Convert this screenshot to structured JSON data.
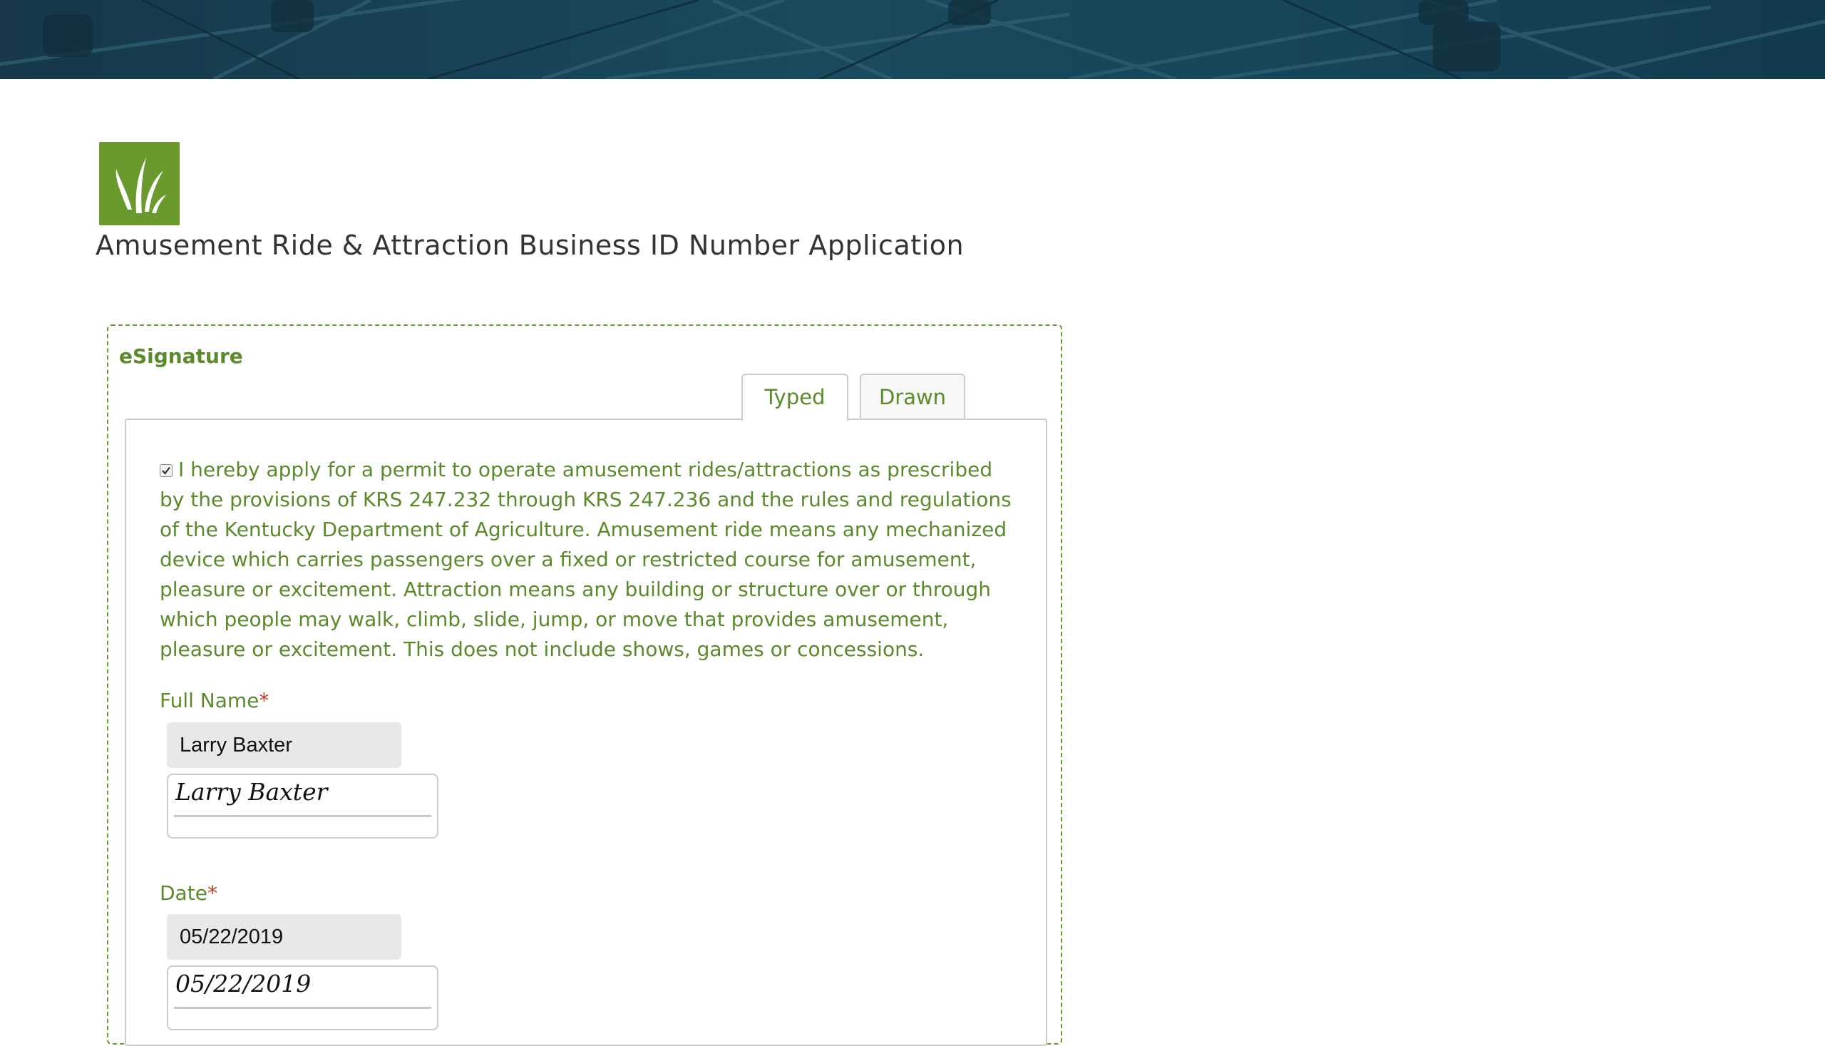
{
  "page": {
    "title": "Amusement Ride & Attraction Business ID Number Application"
  },
  "colors": {
    "accent_green": "#5a8a2a",
    "logo_green": "#6a9a2e",
    "banner_teal": "#1a4a5e",
    "required_red": "#c0392b"
  },
  "icons": {
    "logo": "grass-blades-icon",
    "checkbox": "checkmark-icon"
  },
  "esignature": {
    "legend": "eSignature",
    "tabs": [
      {
        "label": "Typed",
        "selected": true
      },
      {
        "label": "Drawn",
        "selected": false
      }
    ],
    "consent": {
      "checked": true,
      "text": "I hereby apply for a permit to operate amusement rides/attractions as prescribed by the provisions of KRS 247.232 through KRS 247.236 and the rules and regulations of the Kentucky Department of Agriculture. Amusement ride means any mechanized device which carries passengers over a fixed or restricted course for amusement, pleasure or excitement. Attraction means any building or structure over or through which people may walk, climb, slide, jump, or move that provides amusement, pleasure or excitement. This does not include shows, games or concessions."
    },
    "full_name": {
      "label": "Full Name",
      "required_mark": "*",
      "value": "Larry Baxter",
      "signature": "Larry Baxter"
    },
    "date": {
      "label": "Date",
      "required_mark": "*",
      "value": "05/22/2019",
      "signature": "05/22/2019"
    }
  }
}
